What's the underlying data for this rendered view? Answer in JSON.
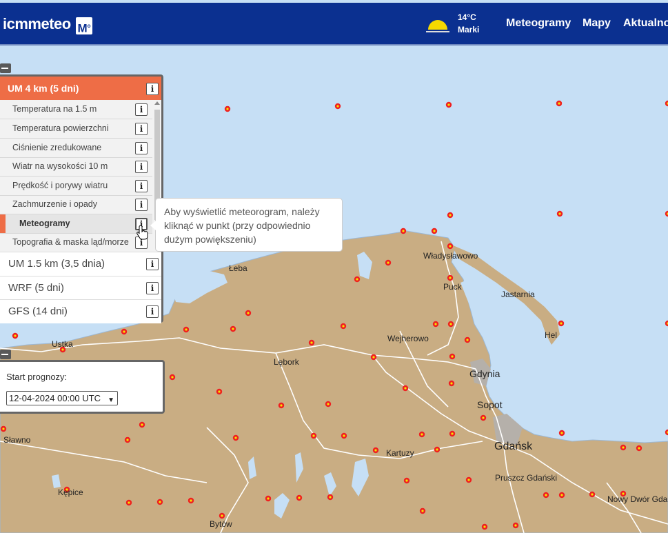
{
  "header": {
    "logo_text": "icmmeteo",
    "logo_badge": "M",
    "weather": {
      "icon": "sun-icon",
      "temperature": "14°C",
      "place": "Marki"
    },
    "nav": [
      "Meteogramy",
      "Mapy",
      "Aktualno"
    ],
    "colors": {
      "bar": "#0b3090"
    }
  },
  "map": {
    "colors": {
      "sea": "#c6dff5",
      "land": "#c9ad83",
      "point": "#ef2020",
      "point_center": "#f6e600"
    },
    "places": [
      "Łeba",
      "Władysławowo",
      "Puck",
      "Jastarnia",
      "Hel",
      "Wejherowo",
      "Gdynia",
      "Sopot",
      "Gdańsk",
      "Pruszcz Gdański",
      "Nowy Dwór Gdański",
      "Kartuzy",
      "Lębork",
      "Ustka",
      "Sławno",
      "Kępice",
      "Bytów"
    ]
  },
  "model_panel": {
    "active_model": "UM 4 km (5 dni)",
    "layers": [
      "Temperatura na 1.5 m",
      "Temperatura powierzchni",
      "Ciśnienie zredukowane",
      "Wiatr na wysokości 10 m",
      "Prędkość i porywy wiatru",
      "Zachmurzenie i opady",
      "Meteogramy",
      "Topografia & maska ląd/morze"
    ],
    "active_layer_index": 6,
    "other_models": [
      "UM 1.5 km (3,5 dnia)",
      "WRF (5 dni)",
      "GFS (14 dni)"
    ],
    "info_label": "i",
    "accent": "#ee6d46"
  },
  "tooltip": {
    "text": "Aby wyświetlić meteorogram, należy kliknąć w punkt (przy odpowiednio dużym powiększeniu)"
  },
  "start_panel": {
    "label": "Start prognozy:",
    "selected": "12-04-2024 00:00 UTC"
  }
}
